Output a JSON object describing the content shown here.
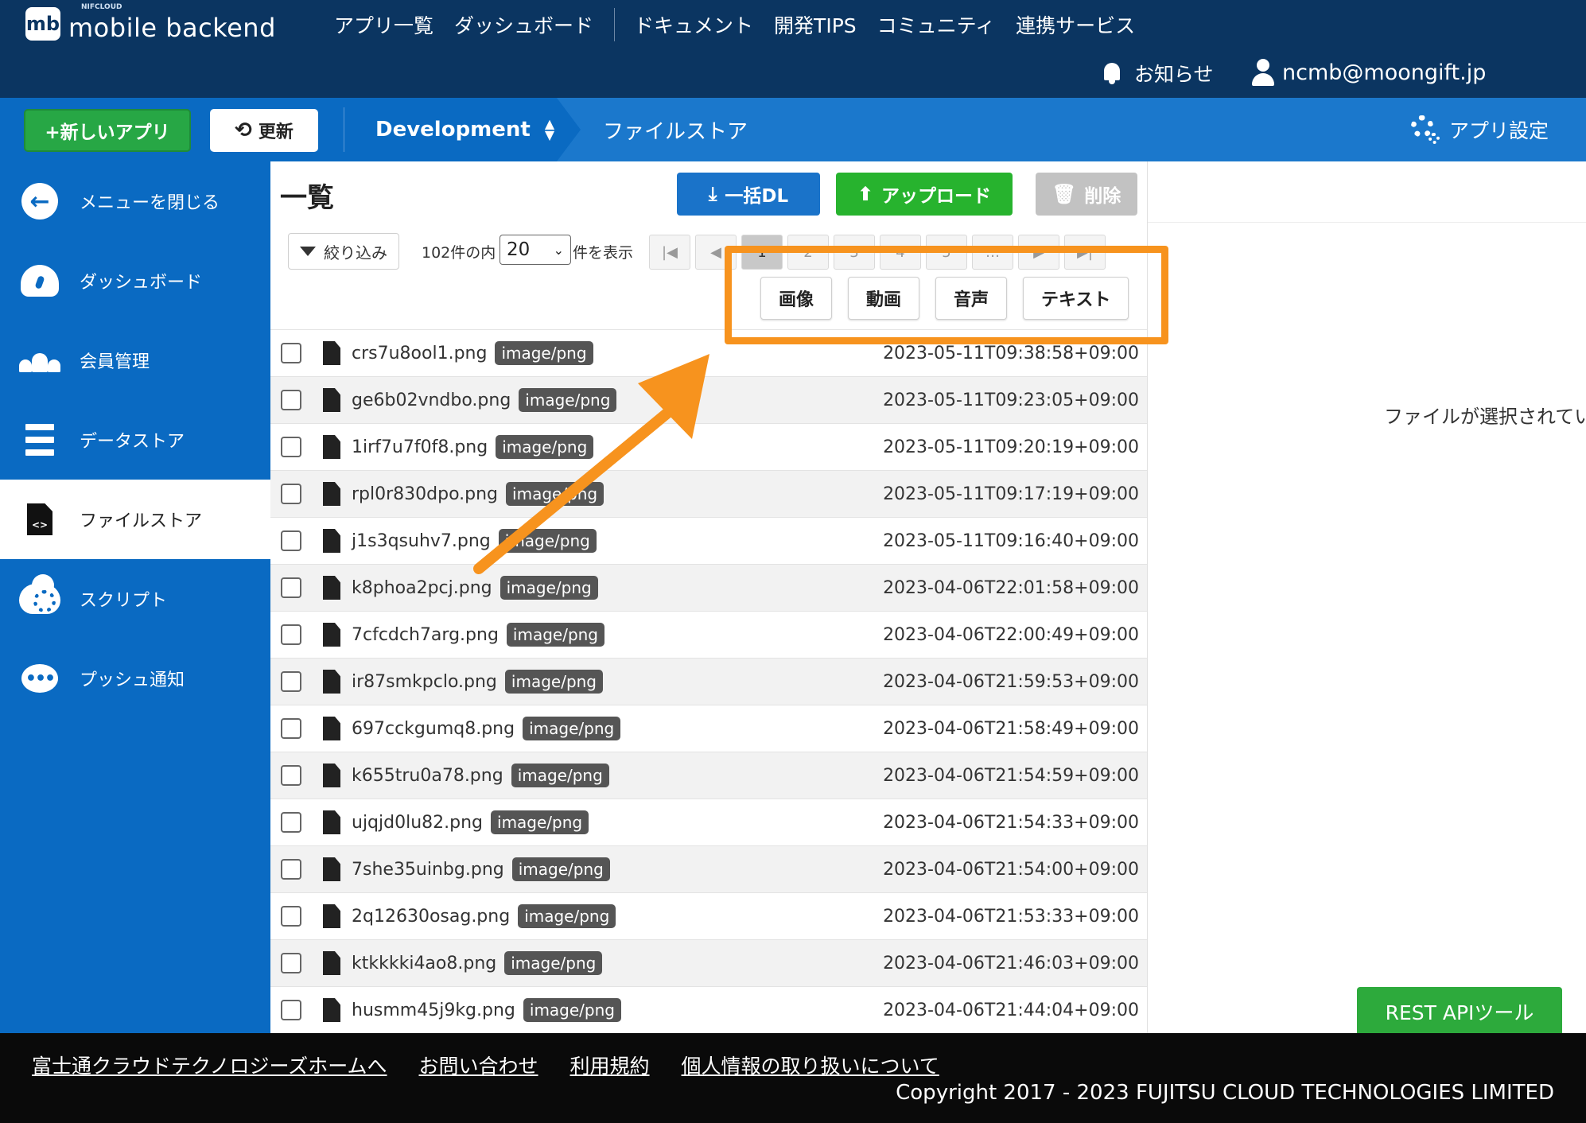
{
  "header": {
    "logo_small": "NIFCLOUD",
    "logo_mark": "mb",
    "logo_text": "mobile backend",
    "nav": [
      "アプリ一覧",
      "ダッシュボード",
      "ドキュメント",
      "開発TIPS",
      "コミュニティ",
      "連携サービス"
    ],
    "notice_label": "お知らせ",
    "user_email": "ncmb@moongift.jp"
  },
  "subbar": {
    "new_app_label": "+新しいアプリ",
    "refresh_label": "更新",
    "env_label": "Development",
    "breadcrumb": "ファイルストア",
    "app_settings_label": "アプリ設定"
  },
  "sidebar": {
    "items": [
      {
        "label": "メニューを閉じる",
        "icon": "arrow-left-icon"
      },
      {
        "label": "ダッシュボード",
        "icon": "gauge-icon"
      },
      {
        "label": "会員管理",
        "icon": "users-icon"
      },
      {
        "label": "データストア",
        "icon": "database-icon"
      },
      {
        "label": "ファイルストア",
        "icon": "file-code-icon",
        "active": true
      },
      {
        "label": "スクリプト",
        "icon": "cloud-gear-icon"
      },
      {
        "label": "プッシュ通知",
        "icon": "chat-bubble-icon"
      }
    ]
  },
  "main": {
    "title": "一覧",
    "bulk_dl_label": "一括DL",
    "upload_label": "アップロード",
    "delete_label": "削除",
    "filter_label": "絞り込み",
    "count_prefix": "102件の内",
    "per_page_value": "20",
    "per_page_suffix": "件を表示",
    "pager": [
      "|◀",
      "◀",
      "1",
      "2",
      "3",
      "4",
      "5",
      "…",
      "▶",
      "▶|"
    ],
    "type_filters": [
      "画像",
      "動画",
      "音声",
      "テキスト"
    ],
    "files": [
      {
        "name": "crs7u8ool1.png",
        "type": "image/png",
        "date": "2023-05-11T09:38:58+09:00"
      },
      {
        "name": "ge6b02vndbo.png",
        "type": "image/png",
        "date": "2023-05-11T09:23:05+09:00"
      },
      {
        "name": "1irf7u7f0f8.png",
        "type": "image/png",
        "date": "2023-05-11T09:20:19+09:00"
      },
      {
        "name": "rpl0r830dpo.png",
        "type": "image/png",
        "date": "2023-05-11T09:17:19+09:00"
      },
      {
        "name": "j1s3qsuhv7.png",
        "type": "image/png",
        "date": "2023-05-11T09:16:40+09:00"
      },
      {
        "name": "k8phoa2pcj.png",
        "type": "image/png",
        "date": "2023-04-06T22:01:58+09:00"
      },
      {
        "name": "7cfcdch7arg.png",
        "type": "image/png",
        "date": "2023-04-06T22:00:49+09:00"
      },
      {
        "name": "ir87smkpclo.png",
        "type": "image/png",
        "date": "2023-04-06T21:59:53+09:00"
      },
      {
        "name": "697cckgumq8.png",
        "type": "image/png",
        "date": "2023-04-06T21:58:49+09:00"
      },
      {
        "name": "k655tru0a78.png",
        "type": "image/png",
        "date": "2023-04-06T21:54:59+09:00"
      },
      {
        "name": "ujqjd0lu82.png",
        "type": "image/png",
        "date": "2023-04-06T21:54:33+09:00"
      },
      {
        "name": "7she35uinbg.png",
        "type": "image/png",
        "date": "2023-04-06T21:54:00+09:00"
      },
      {
        "name": "2q12630osag.png",
        "type": "image/png",
        "date": "2023-04-06T21:53:33+09:00"
      },
      {
        "name": "ktkkkki4ao8.png",
        "type": "image/png",
        "date": "2023-04-06T21:46:03+09:00"
      },
      {
        "name": "husmm45j9kg.png",
        "type": "image/png",
        "date": "2023-04-06T21:44:04+09:00"
      }
    ]
  },
  "detail": {
    "no_file_text": "ファイルが選択されていません",
    "rest_tool_label": "REST APIツール"
  },
  "footer": {
    "links": [
      "富士通クラウドテクノロジーズホームへ",
      "お問い合わせ",
      "利用規約",
      "個人情報の取り扱いについて"
    ],
    "copyright": "Copyright 2017 - 2023 FUJITSU CLOUD TECHNOLOGIES LIMITED"
  },
  "colors": {
    "header_bg": "#0b3561",
    "primary_blue": "#0a6ac2",
    "green": "#27a745",
    "annotation_orange": "#f7931e"
  }
}
